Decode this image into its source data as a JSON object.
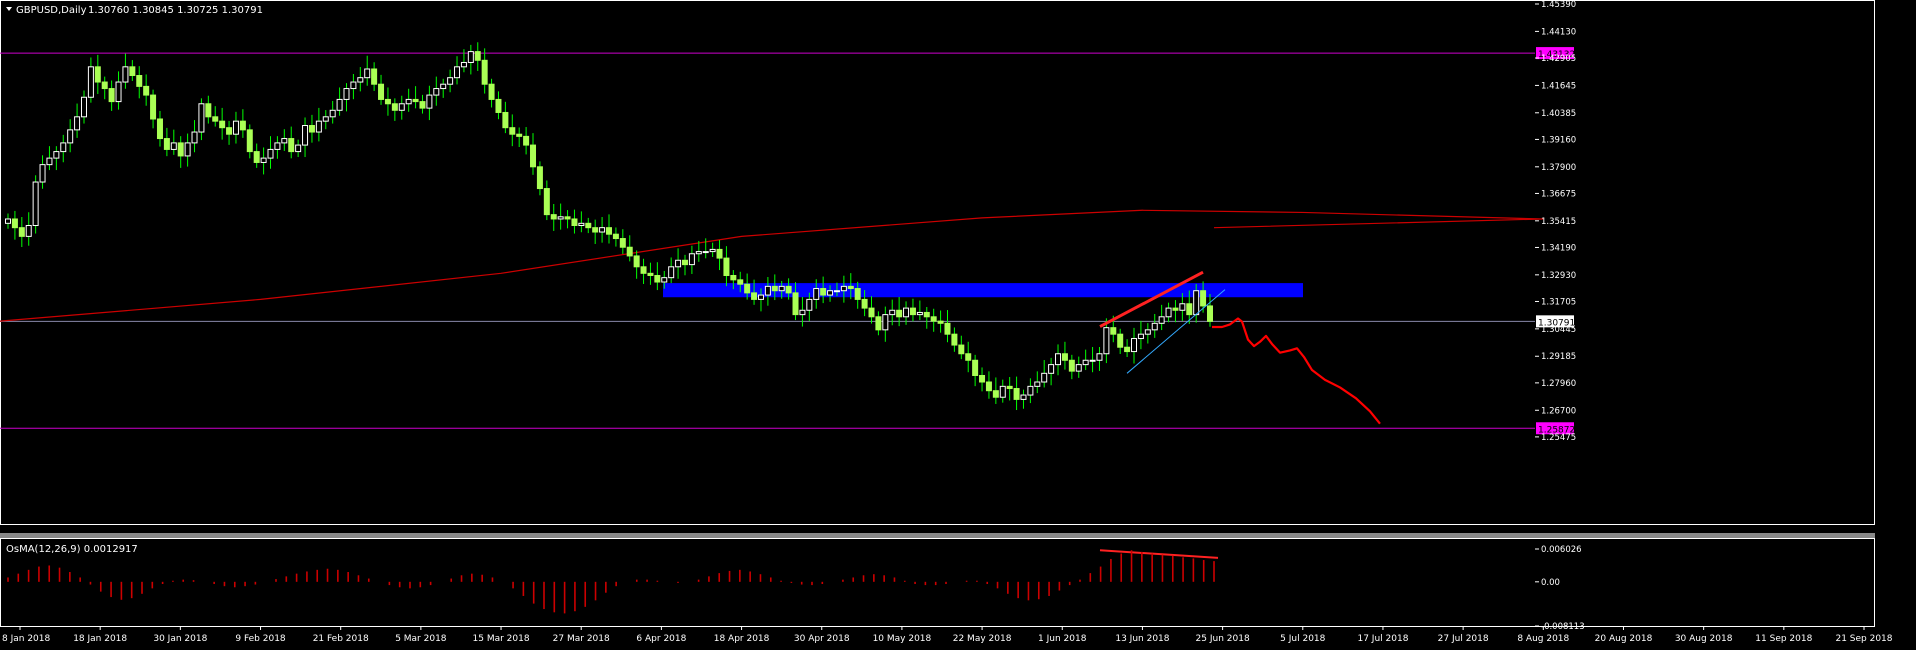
{
  "header": {
    "symbol": "GBPUSD,Daily",
    "ohlc": "1.30760 1.30845 1.30725 1.30791"
  },
  "indicator": {
    "label": "OsMA(12,26,9) 0.0012917",
    "yticks": [
      "0.006026",
      "0.00",
      "-0.008113"
    ]
  },
  "colors": {
    "background": "#000000",
    "candle_up": "#ffffff",
    "candle_down": "#aaff55",
    "wick": "#00ff00",
    "moving_average": "#cc0000",
    "resistance_line": "#cc00cc",
    "price_line": "#8888aa",
    "zone": "#0000ff",
    "trend_red": "#ff2222",
    "trend_blue": "#33aaff",
    "forecast": "#ff0000",
    "osma": "#cc0000",
    "axis_text": "#ffffff",
    "current_price_label_bg": "#ffffff",
    "level_label_bg": "#ff00ff"
  },
  "chart_data": {
    "type": "candlestick",
    "symbol": "GBPUSD",
    "timeframe": "Daily",
    "ylim": [
      1.2547,
      1.4539
    ],
    "y_ticks": [
      "1.45390",
      "1.44130",
      "1.42905",
      "1.41645",
      "1.40385",
      "1.39160",
      "1.37900",
      "1.36675",
      "1.35415",
      "1.34190",
      "1.32930",
      "1.31705",
      "1.30445",
      "1.29185",
      "1.27960",
      "1.26700",
      "1.25475"
    ],
    "x_ticks": [
      "8 Jan 2018",
      "18 Jan 2018",
      "30 Jan 2018",
      "9 Feb 2018",
      "21 Feb 2018",
      "5 Mar 2018",
      "15 Mar 2018",
      "27 Mar 2018",
      "6 Apr 2018",
      "18 Apr 2018",
      "30 Apr 2018",
      "10 May 2018",
      "22 May 2018",
      "1 Jun 2018",
      "13 Jun 2018",
      "25 Jun 2018",
      "5 Jul 2018",
      "17 Jul 2018",
      "27 Jul 2018",
      "8 Aug 2018",
      "20 Aug 2018",
      "30 Aug 2018",
      "11 Sep 2018",
      "21 Sep 2018"
    ],
    "levels": [
      {
        "label": "1.43132",
        "value": 1.43132
      },
      {
        "label": "1.25872",
        "value": 1.25872
      }
    ],
    "current_price": {
      "label": "1.30791",
      "value": 1.30791
    },
    "zone": {
      "low": 1.319,
      "high": 1.3255
    },
    "closes": [
      1.355,
      1.351,
      1.347,
      1.352,
      1.372,
      1.38,
      1.383,
      1.386,
      1.39,
      1.396,
      1.402,
      1.411,
      1.425,
      1.418,
      1.415,
      1.409,
      1.418,
      1.425,
      1.421,
      1.416,
      1.412,
      1.401,
      1.392,
      1.387,
      1.39,
      1.384,
      1.39,
      1.395,
      1.408,
      1.402,
      1.4,
      1.397,
      1.394,
      1.4,
      1.396,
      1.386,
      1.381,
      1.383,
      1.387,
      1.39,
      1.392,
      1.386,
      1.389,
      1.398,
      1.395,
      1.4,
      1.402,
      1.405,
      1.41,
      1.415,
      1.418,
      1.42,
      1.424,
      1.417,
      1.41,
      1.408,
      1.405,
      1.408,
      1.41,
      1.409,
      1.406,
      1.412,
      1.415,
      1.417,
      1.42,
      1.425,
      1.427,
      1.432,
      1.428,
      1.417,
      1.41,
      1.404,
      1.397,
      1.394,
      1.393,
      1.389,
      1.379,
      1.369,
      1.357,
      1.355,
      1.356,
      1.355,
      1.352,
      1.353,
      1.351,
      1.349,
      1.351,
      1.348,
      1.346,
      1.342,
      1.338,
      1.333,
      1.33,
      1.329,
      1.326,
      1.328,
      1.333,
      1.336,
      1.334,
      1.339,
      1.34,
      1.34,
      1.341,
      1.337,
      1.329,
      1.327,
      1.325,
      1.321,
      1.318,
      1.32,
      1.324,
      1.322,
      1.324,
      1.321,
      1.311,
      1.313,
      1.318,
      1.323,
      1.32,
      1.322,
      1.322,
      1.324,
      1.323,
      1.318,
      1.314,
      1.31,
      1.304,
      1.311,
      1.313,
      1.31,
      1.314,
      1.311,
      1.312,
      1.31,
      1.308,
      1.307,
      1.302,
      1.297,
      1.293,
      1.29,
      1.283,
      1.28,
      1.276,
      1.273,
      1.278,
      1.277,
      1.272,
      1.274,
      1.278,
      1.28,
      1.284,
      1.288,
      1.293,
      1.29,
      1.285,
      1.288,
      1.29,
      1.29,
      1.293,
      1.305,
      1.302,
      1.296,
      1.294,
      1.3,
      1.302,
      1.304,
      1.307,
      1.31,
      1.314,
      1.313,
      1.316,
      1.311,
      1.322,
      1.315,
      1.3079
    ],
    "moving_average": [
      {
        "date": "8 Jan 2018",
        "value": 1.308
      },
      {
        "date": "9 Feb 2018",
        "value": 1.318
      },
      {
        "date": "15 Mar 2018",
        "value": 1.33
      },
      {
        "date": "18 Apr 2018",
        "value": 1.347
      },
      {
        "date": "22 May 2018",
        "value": 1.3555
      },
      {
        "date": "13 Jun 2018",
        "value": 1.359
      },
      {
        "date": "5 Jul 2018",
        "value": 1.358
      },
      {
        "date": "8 Aug 2018",
        "value": 1.355
      },
      {
        "date": "21 Sep 2018",
        "value": 1.351
      }
    ],
    "osma": [
      0.0008,
      0.0015,
      0.0022,
      0.0028,
      0.003,
      0.0026,
      0.0018,
      0.0008,
      -0.0005,
      -0.0018,
      -0.0028,
      -0.0033,
      -0.003,
      -0.0022,
      -0.0012,
      -0.0004,
      0.0002,
      0.0004,
      0.0003,
      0.0,
      -0.0004,
      -0.0008,
      -0.001,
      -0.0008,
      -0.0005,
      0.0,
      0.0005,
      0.001,
      0.0015,
      0.0019,
      0.0022,
      0.0024,
      0.0022,
      0.0018,
      0.0012,
      0.0006,
      0.0,
      -0.0006,
      -0.001,
      -0.0012,
      -0.001,
      -0.0006,
      0.0,
      0.0006,
      0.0012,
      0.0015,
      0.0013,
      0.0008,
      0.0,
      -0.0012,
      -0.0026,
      -0.004,
      -0.005,
      -0.0056,
      -0.0058,
      -0.0054,
      -0.0046,
      -0.0034,
      -0.002,
      -0.0008,
      0.0,
      0.0004,
      0.0004,
      0.0002,
      0.0,
      -0.0002,
      0.0,
      0.0004,
      0.001,
      0.0016,
      0.002,
      0.0022,
      0.0019,
      0.0014,
      0.0008,
      0.0002,
      -0.0002,
      -0.0005,
      -0.0006,
      -0.0004,
      0.0,
      0.0004,
      0.0008,
      0.0012,
      0.0014,
      0.0012,
      0.0008,
      0.0002,
      -0.0004,
      -0.0006,
      -0.0006,
      -0.0004,
      0.0,
      0.0002,
      0.0002,
      -0.0004,
      -0.0012,
      -0.0022,
      -0.003,
      -0.0034,
      -0.0032,
      -0.0026,
      -0.0016,
      -0.0006,
      0.0004,
      0.0016,
      0.0028,
      0.0042,
      0.0052,
      0.0058,
      0.0055,
      0.0052,
      0.005,
      0.0048,
      0.0045,
      0.0043,
      0.004,
      0.0038
    ]
  }
}
